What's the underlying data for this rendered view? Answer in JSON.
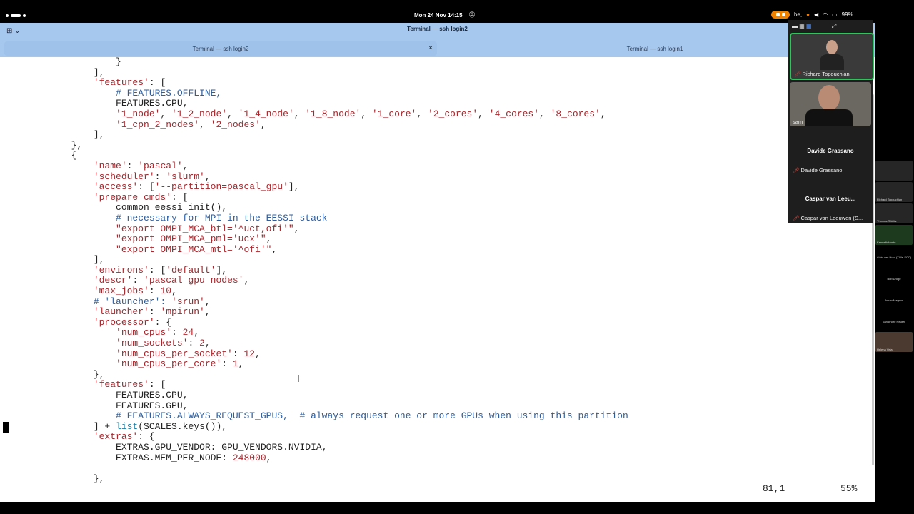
{
  "menubar": {
    "clock": "Mon 24 Nov  14:15",
    "input_source": "be,",
    "battery": "99%"
  },
  "window": {
    "title": "Terminal — ssh login2",
    "tabs": [
      {
        "label": "Terminal — ssh login2",
        "active": true
      },
      {
        "label": "Terminal — ssh login1",
        "active": false
      }
    ],
    "tab_close": "×"
  },
  "code": {
    "lines": [
      [
        [
          "t",
          "                    }"
        ]
      ],
      [
        [
          "t",
          "                ],"
        ]
      ],
      [
        [
          "s",
          "                'features'"
        ],
        [
          "t",
          ": ["
        ]
      ],
      [
        [
          "c",
          "                    # FEATURES.OFFLINE,"
        ]
      ],
      [
        [
          "t",
          "                    FEATURES.CPU,"
        ]
      ],
      [
        [
          "s",
          "                    '1_node'"
        ],
        [
          "t",
          ", "
        ],
        [
          "s",
          "'1_2_node'"
        ],
        [
          "t",
          ", "
        ],
        [
          "s",
          "'1_4_node'"
        ],
        [
          "t",
          ", "
        ],
        [
          "s",
          "'1_8_node'"
        ],
        [
          "t",
          ", "
        ],
        [
          "s",
          "'1_core'"
        ],
        [
          "t",
          ", "
        ],
        [
          "s",
          "'2_cores'"
        ],
        [
          "t",
          ", "
        ],
        [
          "s",
          "'4_cores'"
        ],
        [
          "t",
          ", "
        ],
        [
          "s",
          "'8_cores'"
        ],
        [
          "t",
          ","
        ]
      ],
      [
        [
          "s",
          "                    '1_cpn_2_nodes'"
        ],
        [
          "t",
          ", "
        ],
        [
          "s",
          "'2_nodes'"
        ],
        [
          "t",
          ","
        ]
      ],
      [
        [
          "t",
          "                ],"
        ]
      ],
      [
        [
          "t",
          "            },"
        ]
      ],
      [
        [
          "t",
          "            {"
        ]
      ],
      [
        [
          "s",
          "                'name'"
        ],
        [
          "t",
          ": "
        ],
        [
          "s",
          "'pascal'"
        ],
        [
          "t",
          ","
        ]
      ],
      [
        [
          "s",
          "                'scheduler'"
        ],
        [
          "t",
          ": "
        ],
        [
          "s",
          "'slurm'"
        ],
        [
          "t",
          ","
        ]
      ],
      [
        [
          "s",
          "                'access'"
        ],
        [
          "t",
          ": ["
        ],
        [
          "s",
          "'--partition=pascal_gpu'"
        ],
        [
          "t",
          "],"
        ]
      ],
      [
        [
          "s",
          "                'prepare_cmds'"
        ],
        [
          "t",
          ": ["
        ]
      ],
      [
        [
          "t",
          "                    common_eessi_init(),"
        ]
      ],
      [
        [
          "c",
          "                    # necessary for MPI in the EESSI stack"
        ]
      ],
      [
        [
          "s",
          "                    \"export OMPI_MCA_btl='^uct,ofi'\""
        ],
        [
          "t",
          ","
        ]
      ],
      [
        [
          "s",
          "                    \"export OMPI_MCA_pml='ucx'\""
        ],
        [
          "t",
          ","
        ]
      ],
      [
        [
          "s",
          "                    \"export OMPI_MCA_mtl='^ofi'\""
        ],
        [
          "t",
          ","
        ]
      ],
      [
        [
          "t",
          "                ],"
        ]
      ],
      [
        [
          "s",
          "                'environs'"
        ],
        [
          "t",
          ": ["
        ],
        [
          "s",
          "'default'"
        ],
        [
          "t",
          "],"
        ]
      ],
      [
        [
          "s",
          "                'descr'"
        ],
        [
          "t",
          ": "
        ],
        [
          "s",
          "'pascal gpu nodes'"
        ],
        [
          "t",
          ","
        ]
      ],
      [
        [
          "s",
          "                'max_jobs'"
        ],
        [
          "t",
          ": "
        ],
        [
          "s",
          "10"
        ],
        [
          "t",
          ","
        ]
      ],
      [
        [
          "c",
          "                # 'launcher'"
        ],
        [
          "c",
          ": "
        ],
        [
          "s",
          "'srun'"
        ],
        [
          "t",
          ","
        ]
      ],
      [
        [
          "s",
          "                'launcher'"
        ],
        [
          "t",
          ": "
        ],
        [
          "s",
          "'mpirun'"
        ],
        [
          "t",
          ","
        ]
      ],
      [
        [
          "s",
          "                'processor'"
        ],
        [
          "t",
          ": {"
        ]
      ],
      [
        [
          "s",
          "                    'num_cpus'"
        ],
        [
          "t",
          ": "
        ],
        [
          "s",
          "24"
        ],
        [
          "t",
          ","
        ]
      ],
      [
        [
          "s",
          "                    'num_sockets'"
        ],
        [
          "t",
          ": "
        ],
        [
          "s",
          "2"
        ],
        [
          "t",
          ","
        ]
      ],
      [
        [
          "s",
          "                    'num_cpus_per_socket'"
        ],
        [
          "t",
          ": "
        ],
        [
          "s",
          "12"
        ],
        [
          "t",
          ","
        ]
      ],
      [
        [
          "s",
          "                    'num_cpus_per_core'"
        ],
        [
          "t",
          ": "
        ],
        [
          "s",
          "1"
        ],
        [
          "t",
          ","
        ]
      ],
      [
        [
          "t",
          "                },"
        ]
      ],
      [
        [
          "s",
          "                'features'"
        ],
        [
          "t",
          ": ["
        ]
      ],
      [
        [
          "t",
          "                    FEATURES.CPU,"
        ]
      ],
      [
        [
          "t",
          "                    FEATURES.GPU,"
        ]
      ],
      [
        [
          "c",
          "                    # FEATURES.ALWAYS_REQUEST_GPUS,  # always request one or more GPUs when using this partition"
        ]
      ],
      [
        [
          "t",
          "                ] + "
        ],
        [
          "b",
          "list"
        ],
        [
          "t",
          "(SCALES.keys()),"
        ]
      ],
      [
        [
          "s",
          "                'extras'"
        ],
        [
          "t",
          ": {"
        ]
      ],
      [
        [
          "t",
          "                    EXTRAS.GPU_VENDOR: GPU_VENDORS.NVIDIA,"
        ]
      ],
      [
        [
          "t",
          "                    EXTRAS.MEM_PER_NODE: "
        ],
        [
          "s",
          "248000"
        ],
        [
          "t",
          ","
        ]
      ],
      [
        [
          "t",
          ""
        ]
      ],
      [
        [
          "t",
          "                },"
        ]
      ]
    ]
  },
  "statusline": {
    "position": "81,1",
    "percent": "55%"
  },
  "call": {
    "participants": [
      {
        "name": "Richard Topouchian",
        "muted": true
      },
      {
        "name": "sam",
        "muted": false
      },
      {
        "name": "Davide Grassano",
        "display": "Davide Grassano",
        "muted": true
      },
      {
        "name": "Caspar van Leeuwen (S...",
        "display": "Caspar van Leeu...",
        "muted": true
      }
    ],
    "strip": [
      "",
      "Richard Topouchian",
      "Thomas Röblitz",
      "Kenneth Hoste",
      "Alain van Hoof (TU/e-SCC)",
      "Bob Dröge",
      "Johan Magnus",
      "Jan André Reuter",
      "Helena Vela"
    ]
  },
  "colors": {
    "titlebar": "#a6c8ef",
    "string": "#a8262c",
    "comment": "#2e5d9a",
    "active_speaker": "#2ec65b"
  }
}
